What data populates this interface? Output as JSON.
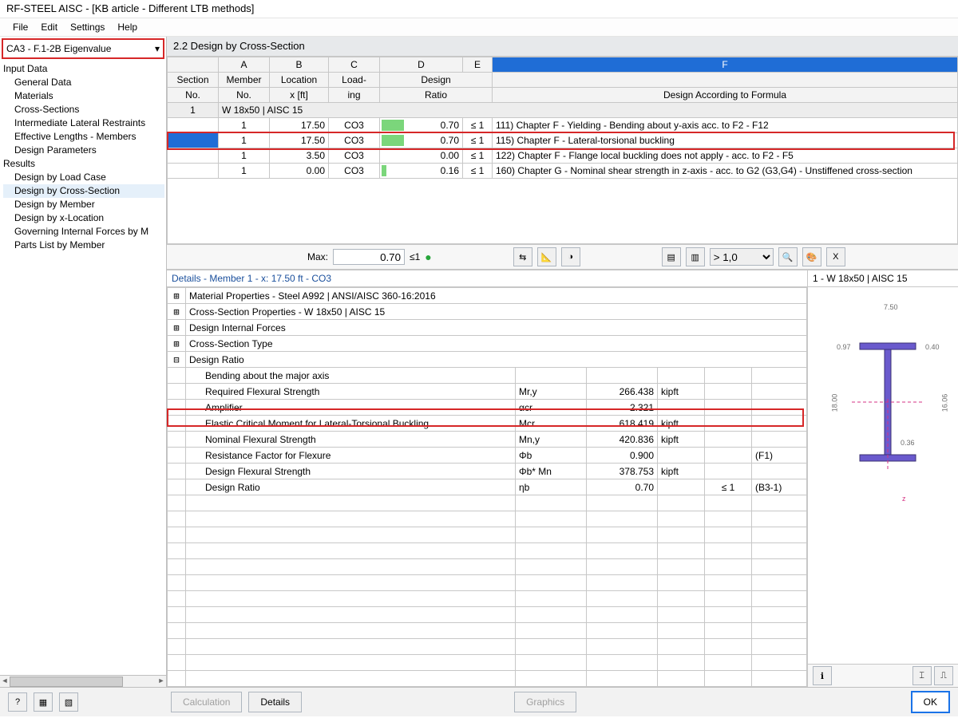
{
  "window_title": "RF-STEEL AISC - [KB article - Different LTB methods]",
  "menu": [
    "File",
    "Edit",
    "Settings",
    "Help"
  ],
  "selector_value": "CA3 - F.1-2B Eigenvalue",
  "tree": {
    "input_header": "Input Data",
    "input_items": [
      "General Data",
      "Materials",
      "Cross-Sections",
      "Intermediate Lateral Restraints",
      "Effective Lengths - Members",
      "Design Parameters"
    ],
    "results_header": "Results",
    "results_items": [
      "Design by Load Case",
      "Design by Cross-Section",
      "Design by Member",
      "Design by x-Location",
      "Governing Internal Forces by M",
      "Parts List by Member"
    ]
  },
  "section_title": "2.2 Design by Cross-Section",
  "grid_headers": {
    "letters": [
      "A",
      "B",
      "C",
      "D",
      "E",
      "F"
    ],
    "row1": [
      "Section",
      "Member",
      "Location",
      "Load-",
      "Design",
      ""
    ],
    "row2": [
      "No.",
      "No.",
      "x [ft]",
      "ing",
      "Ratio",
      "Design According to Formula"
    ]
  },
  "group_row": {
    "section_no": "1",
    "label": "W 18x50 | AISC 15"
  },
  "data_rows": [
    {
      "member": "1",
      "x": "17.50",
      "loading": "CO3",
      "ratio": "0.70",
      "cond": "≤ 1",
      "formula": "111) Chapter F - Yielding - Bending about y-axis acc. to F2 - F12"
    },
    {
      "member": "1",
      "x": "17.50",
      "loading": "CO3",
      "ratio": "0.70",
      "cond": "≤ 1",
      "formula": "115) Chapter F - Lateral-torsional buckling",
      "selected": true
    },
    {
      "member": "1",
      "x": "3.50",
      "loading": "CO3",
      "ratio": "0.00",
      "cond": "≤ 1",
      "formula": "122) Chapter F - Flange local buckling does not apply - acc. to F2 - F5"
    },
    {
      "member": "1",
      "x": "0.00",
      "loading": "CO3",
      "ratio": "0.16",
      "cond": "≤ 1",
      "formula": "160) Chapter G - Nominal shear strength in z-axis - acc. to G2 (G3,G4) - Unstiffened cross-section"
    }
  ],
  "max_label": "Max:",
  "max_value": "0.70",
  "max_cond": "≤1",
  "toolbar_select": "> 1,0",
  "details_title": "Details - Member 1 - x: 17.50 ft - CO3",
  "detail_groups": [
    {
      "exp": "⊞",
      "label": "Material Properties - Steel A992 | ANSI/AISC 360-16:2016"
    },
    {
      "exp": "⊞",
      "label": "Cross-Section Properties  -  W 18x50 | AISC 15"
    },
    {
      "exp": "⊞",
      "label": "Design Internal Forces"
    },
    {
      "exp": "⊞",
      "label": "Cross-Section Type"
    },
    {
      "exp": "⊟",
      "label": "Design Ratio"
    }
  ],
  "detail_rows": [
    {
      "label": "Bending about the major axis",
      "sym": "",
      "val": "",
      "unit": "",
      "c1": "",
      "note": ""
    },
    {
      "label": "Required Flexural Strength",
      "sym": "Mr,y",
      "val": "266.438",
      "unit": "kipft",
      "c1": "",
      "note": ""
    },
    {
      "label": "Amplifier",
      "sym": "αcr",
      "val": "2.321",
      "unit": "",
      "c1": "",
      "note": ""
    },
    {
      "label": "Elastic Critical Moment for Lateral-Torsional Buckling",
      "sym": "Mcr",
      "val": "618.419",
      "unit": "kipft",
      "c1": "",
      "note": "",
      "highlight": true
    },
    {
      "label": "Nominal Flexural Strength",
      "sym": "Mn,y",
      "val": "420.836",
      "unit": "kipft",
      "c1": "",
      "note": ""
    },
    {
      "label": "Resistance Factor for Flexure",
      "sym": "Φb",
      "val": "0.900",
      "unit": "",
      "c1": "",
      "note": "(F1)"
    },
    {
      "label": "Design Flexural Strength",
      "sym": "Φb* Mn",
      "val": "378.753",
      "unit": "kipft",
      "c1": "",
      "note": ""
    },
    {
      "label": "Design Ratio",
      "sym": "ηb",
      "val": "0.70",
      "unit": "",
      "c1": "≤ 1",
      "note": "(B3-1)"
    }
  ],
  "preview_title": "1 - W 18x50 | AISC 15",
  "ibeam_dims": {
    "bf": "7.50",
    "d": "18.00",
    "tf": "0.97",
    "tf2": "0.40",
    "tw": "0.36",
    "d2": "16.06",
    "z": "z"
  },
  "footer": {
    "calc": "Calculation",
    "details": "Details",
    "graphics": "Graphics",
    "ok": "OK"
  }
}
